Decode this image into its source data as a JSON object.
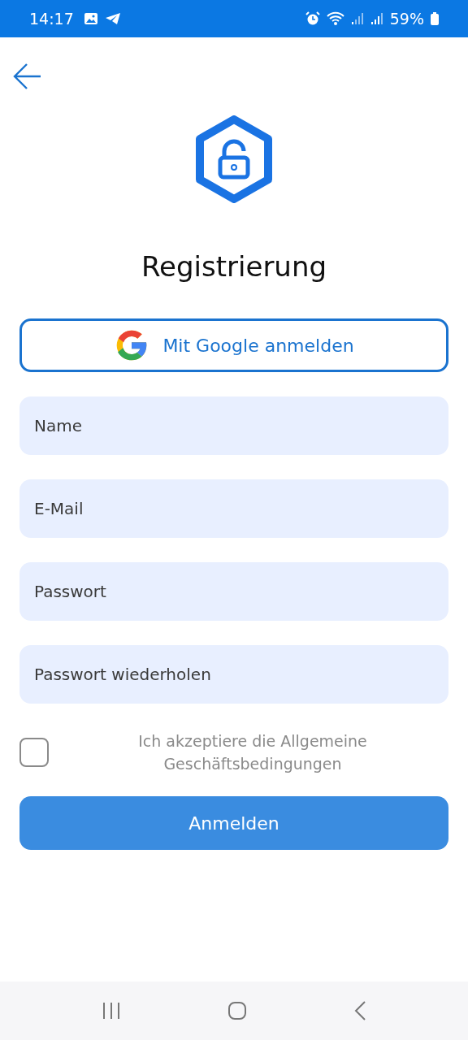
{
  "status_bar": {
    "time": "14:17",
    "battery": "59%"
  },
  "title": "Registrierung",
  "google_button": {
    "label": "Mit Google anmelden"
  },
  "fields": [
    {
      "placeholder": "Name"
    },
    {
      "placeholder": "E-Mail"
    },
    {
      "placeholder": "Passwort"
    },
    {
      "placeholder": "Passwort wiederholen"
    }
  ],
  "terms": {
    "checked": false,
    "label": "Ich akzeptiere die Allgemeine Geschäftsbedingungen"
  },
  "submit_button": {
    "label": "Anmelden"
  }
}
